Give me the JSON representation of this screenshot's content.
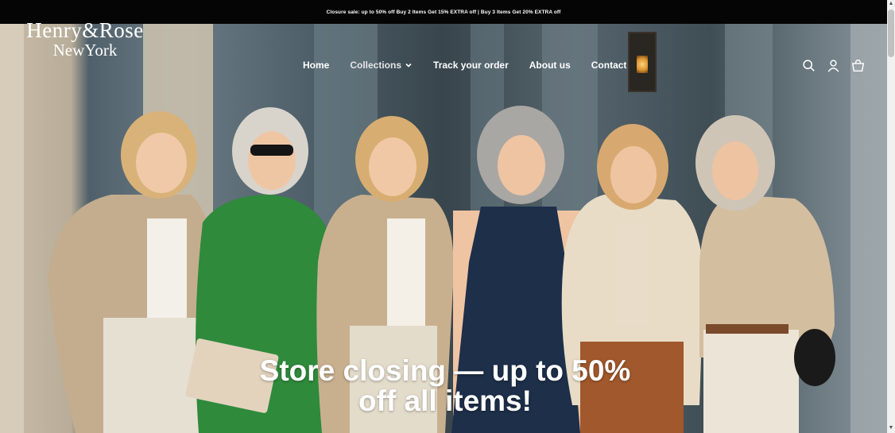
{
  "announcement": "Closure sale: up to 50% off Buy 2 Items Get 15% EXTRA off | Buy 3 Items Get 20% EXTRA off",
  "logo": {
    "line1": "Henry&Rose",
    "line2": "NewYork"
  },
  "nav": [
    {
      "label": "Home"
    },
    {
      "label": "Collections",
      "has_dropdown": true
    },
    {
      "label": "Track your order"
    },
    {
      "label": "About us"
    },
    {
      "label": "Contact"
    }
  ],
  "header_icons": [
    "search-icon",
    "account-icon",
    "cart-icon"
  ],
  "hero": {
    "headline": "Store closing — up to 50% off all items!"
  },
  "colors": {
    "announcement_bg": "#050505",
    "text": "#ffffff"
  }
}
